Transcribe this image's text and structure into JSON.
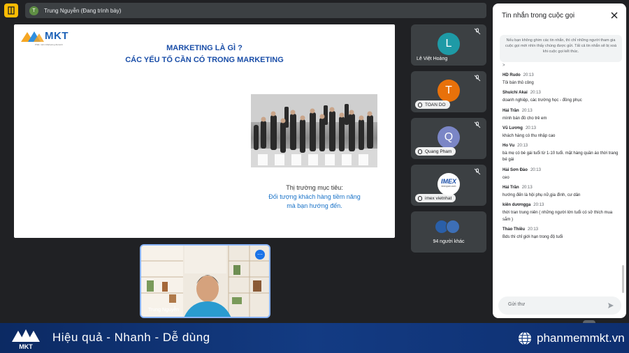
{
  "top_bar": {
    "presenter_initial": "T",
    "presenter_label": "Trung Nguyễn (Đang trình bày)"
  },
  "slide": {
    "logo_text": "MKT",
    "logo_subtitle": "Phần mềm Marketing đa kênh",
    "title_line1": "MARKETING LÀ GÌ ?",
    "title_line2": "CÁC YẾU TỐ CẦN CÓ TRONG MARKETING",
    "caption_line1": "Thị trường mục tiêu:",
    "caption_line2": "Đối tượng khách hàng tiềm năng",
    "caption_line3": "mà bạn hướng đến."
  },
  "participants": [
    {
      "initial": "L",
      "name": "Lê Việt Hoàng",
      "color": "#1e9aa6"
    },
    {
      "initial": "T",
      "name": "TOAN DO",
      "color": "#e8710a"
    },
    {
      "initial": "Q",
      "name": "Quang Pham",
      "color": "#7b86c6"
    },
    {
      "logo_text": "IMEX",
      "logo_sub": "imexpan.com",
      "name": "imex vietnhat"
    }
  ],
  "others": {
    "label": "94 người khác"
  },
  "camera": {
    "name": "Trung Nguyễn"
  },
  "chat": {
    "title": "Tin nhắn trong cuộc gọi",
    "notice": "Nếu bạn không ghim các tin nhắn, thì chỉ những người tham gia cuộc gọi mới nhìn thấy chúng được gửi. Tất cả tin nhắn sẽ bị xoá khi cuộc gọi kết thúc.",
    "caret": ">",
    "messages": [
      {
        "sender": "HD Rudo",
        "time": "20:13",
        "text": "Tôi bán thủ công"
      },
      {
        "sender": "Shuichi Akai",
        "time": "20:13",
        "text": "doanh nghiệp, các trường học - đồng phục"
      },
      {
        "sender": "Hải Trần",
        "time": "20:13",
        "text": "mình bán đồ cho trẻ em"
      },
      {
        "sender": "Vũ Lương",
        "time": "20:13",
        "text": "khách hàng có thu nhập cao"
      },
      {
        "sender": "Ho Vu",
        "time": "20:13",
        "text": "bà mẹ có bé gái tuổi từ 1-10 tuổi. mặt hàng quần áo thời trang bé gái"
      },
      {
        "sender": "Hải Sơn Đào",
        "time": "20:13",
        "text": "ceo"
      },
      {
        "sender": "Hải Trần",
        "time": "20:13",
        "text": "hướng đến là hội phụ nữ,gia đình, cư dân"
      },
      {
        "sender": "kiên dươngga",
        "time": "20:13",
        "text": "thời tran trung niên ( những người lớn tuổi có sở thích mua sắm )"
      },
      {
        "sender": "Thảo Thiều",
        "time": "20:13",
        "text": "Bds thì chỉ giới hạn trong độ tuổi"
      }
    ],
    "input_placeholder": "Gửi thư"
  },
  "banner": {
    "logo_text": "MKT",
    "slogan": "Hiệu quả - Nhanh - Dễ dùng",
    "url": "phanmemmkt.vn"
  },
  "colors": {
    "accent": "#1a73e8",
    "slide_title": "#1a4ea8",
    "banner": "#133b83"
  }
}
